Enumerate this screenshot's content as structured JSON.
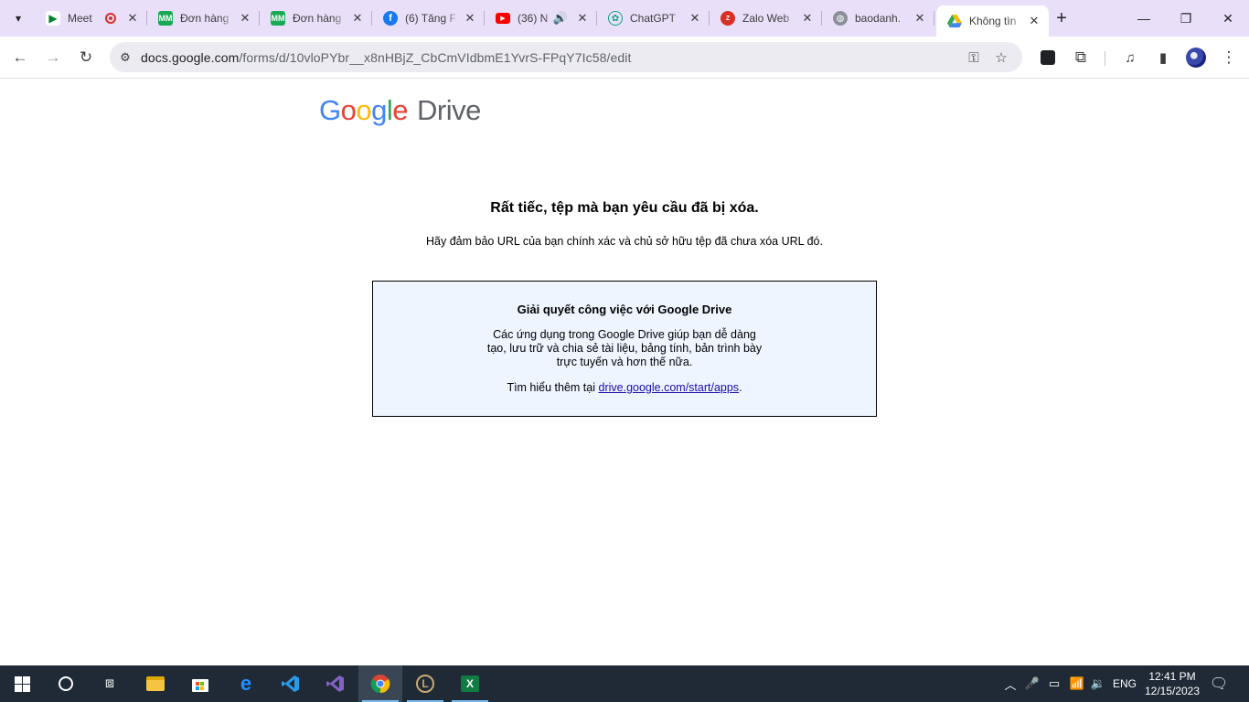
{
  "browser": {
    "tabs": [
      {
        "title": "Meet",
        "favicon": "meet-icon",
        "color": "#00832d",
        "recording": true
      },
      {
        "title": "Đơn hàng",
        "favicon": "mm-icon",
        "color": "#1aaa55"
      },
      {
        "title": "Đơn hàng",
        "favicon": "mm-icon",
        "color": "#1aaa55"
      },
      {
        "title": "(6) Tăng F",
        "favicon": "facebook-icon",
        "color": "#1877f2"
      },
      {
        "title": "(36) N",
        "favicon": "youtube-icon",
        "color": "#ff0000",
        "audio": true
      },
      {
        "title": "ChatGPT",
        "favicon": "chatgpt-icon",
        "color": "#10a37f"
      },
      {
        "title": "Zalo Web",
        "favicon": "zalo-icon",
        "color": "#d93025"
      },
      {
        "title": "baodanh.",
        "favicon": "globe-icon",
        "color": "#5f6368"
      },
      {
        "title": "Không tìn",
        "favicon": "drive-icon",
        "color": "#4285f4",
        "active": true
      }
    ],
    "url": {
      "host": "docs.google.com",
      "path": "/forms/d/10vloPYbr__x8nHBjZ_CbCmVIdbmE1YvrS-FPqY7Ic58/edit"
    }
  },
  "page": {
    "logo": {
      "google": "Google",
      "product": "Drive"
    },
    "error_title": "Rất tiếc, tệp mà bạn yêu cầu đã bị xóa.",
    "error_subtitle": "Hãy đảm bảo URL của bạn chính xác và chủ sở hữu tệp đã chưa xóa URL đó.",
    "info_box": {
      "title": "Giải quyết công việc với Google Drive",
      "body": "Các ứng dụng trong Google Drive giúp bạn dễ dàng tạo, lưu trữ và chia sẻ tài liệu, bảng tính, bản trình bày trực tuyến và hơn thế nữa.",
      "more_prefix": "Tìm hiểu thêm tại",
      "more_link": "drive.google.com/start/apps",
      "more_suffix": "."
    }
  },
  "taskbar": {
    "language": "ENG",
    "time": "12:41 PM",
    "date": "12/15/2023"
  },
  "colors": {
    "tab_strip": "#e9dff9",
    "info_box_bg": "#eef5ff",
    "taskbar_bg": "#1f2a36"
  }
}
